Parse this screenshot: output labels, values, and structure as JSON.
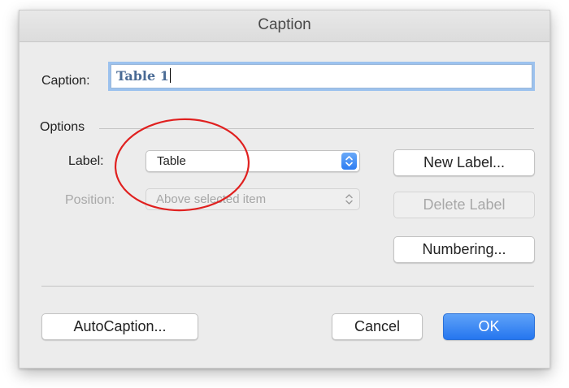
{
  "dialog": {
    "title": "Caption"
  },
  "caption": {
    "label": "Caption:",
    "value": "Table 1"
  },
  "options": {
    "section_label": "Options",
    "label_field": {
      "label": "Label:",
      "selected": "Table"
    },
    "position_field": {
      "label": "Position:",
      "selected": "Above selected item"
    }
  },
  "buttons": {
    "new_label": "New Label...",
    "delete_label": "Delete Label",
    "numbering": "Numbering...",
    "autocaption": "AutoCaption...",
    "cancel": "Cancel",
    "ok": "OK"
  },
  "colors": {
    "accent": "#2d7df2",
    "annotation": "#e0201f",
    "dialog_bg": "#ececec"
  },
  "icons": {
    "label_select": "updown-chevron-icon",
    "position_select": "updown-chevron-icon"
  }
}
